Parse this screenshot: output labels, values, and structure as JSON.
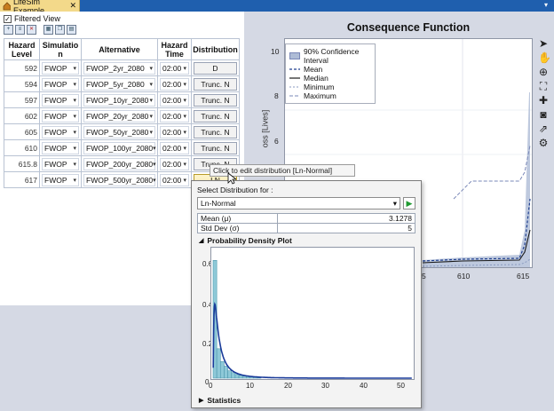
{
  "window": {
    "tab_title": "LifeSim Example",
    "close_glyph": "✕",
    "dropdown_glyph": "▾"
  },
  "left": {
    "filtered_view_label": "Filtered View",
    "filtered_view_checked": true,
    "toolbar_icons": [
      "add-row-icon",
      "insert-row-icon",
      "delete-row-icon",
      "table-icon",
      "copy-icon",
      "paste-icon"
    ]
  },
  "grid": {
    "headers": [
      "Hazard Level",
      "Simulatio n",
      "Alternative",
      "Hazard Time",
      "Distribution"
    ],
    "rows": [
      {
        "level": "592",
        "sim": "FWOP",
        "alt": "FWOP_2yr_2080",
        "time": "02:00",
        "dist": "D"
      },
      {
        "level": "594",
        "sim": "FWOP",
        "alt": "FWOP_5yr_2080",
        "time": "02:00",
        "dist": "Trunc. N"
      },
      {
        "level": "597",
        "sim": "FWOP",
        "alt": "FWOP_10yr_2080",
        "time": "02:00",
        "dist": "Trunc. N"
      },
      {
        "level": "602",
        "sim": "FWOP",
        "alt": "FWOP_20yr_2080",
        "time": "02:00",
        "dist": "Trunc. N"
      },
      {
        "level": "605",
        "sim": "FWOP",
        "alt": "FWOP_50yr_2080",
        "time": "02:00",
        "dist": "Trunc. N"
      },
      {
        "level": "610",
        "sim": "FWOP",
        "alt": "FWOP_100yr_2080",
        "time": "02:00",
        "dist": "Trunc. N"
      },
      {
        "level": "615.8",
        "sim": "FWOP",
        "alt": "FWOP_200yr_2080",
        "time": "02:00",
        "dist": "Trunc. N"
      },
      {
        "level": "617",
        "sim": "FWOP",
        "alt": "FWOP_500yr_2080",
        "time": "02:00",
        "dist": "LN"
      }
    ]
  },
  "chart": {
    "title": "Consequence Function",
    "ylabel_visible": "oss [Lives]",
    "legend": [
      "90% Confidence Interval",
      "Mean",
      "Median",
      "Minimum",
      "Maximum"
    ],
    "yticks": [
      "10",
      "8",
      "6"
    ],
    "xticks_visible": [
      "5",
      "610",
      "615"
    ],
    "colors": {
      "band": "#aebcd6",
      "mean": "#1f3f8f",
      "median": "#1a1a1a",
      "minimum": "#8a9ac0",
      "maximum": "#7a88b8"
    }
  },
  "side_tools": [
    "pointer-icon",
    "pan-hand-icon",
    "zoom-icon",
    "zoom-extents-icon",
    "crosshair-icon",
    "camera-icon",
    "export-icon",
    "settings-icon"
  ],
  "tooltip": "Click to edit distribution [Ln-Normal]",
  "popup": {
    "select_label": "Select Distribution for :",
    "selected": "Ln-Normal",
    "params": [
      {
        "name": "Mean (μ)",
        "value": "3.1278"
      },
      {
        "name": "Std Dev (σ)",
        "value": "5"
      }
    ],
    "pdf_title": "Probability Density Plot",
    "stats_title": "Statistics",
    "expanded_glyph": "◢",
    "collapsed_glyph": "▶",
    "play_glyph": "▶",
    "pdf_yticks": [
      "0.6",
      "0.4",
      "0.2",
      "0"
    ],
    "pdf_xticks": [
      "0",
      "10",
      "20",
      "30",
      "40",
      "50"
    ],
    "pdf_xmax": 54,
    "pdf_ymax": 0.68,
    "histogram_x": [
      0.5,
      1.5,
      2.5,
      3.5,
      4.5,
      5.5,
      6.5,
      7.5,
      8.5,
      9.5,
      10.5,
      11.5,
      12.5
    ],
    "histogram_y": [
      0.64,
      0.16,
      0.09,
      0.065,
      0.04,
      0.03,
      0.02,
      0.015,
      0.012,
      0.01,
      0.008,
      0.005,
      0.003
    ],
    "colors": {
      "bars": "#8ec9d8",
      "bar_edge": "#4e97ad",
      "curve": "#1a3b9a"
    }
  }
}
